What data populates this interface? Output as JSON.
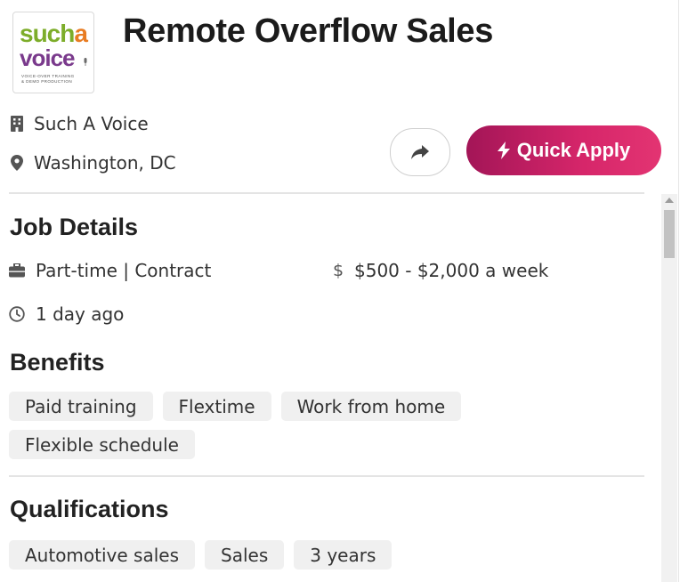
{
  "company_logo": {
    "line1a": "such",
    "line1b": "a",
    "line2": "voice",
    "tagline1": "VOICE-OVER TRAINING",
    "tagline2": "& DEMO PRODUCTION"
  },
  "job": {
    "title": "Remote Overflow Sales",
    "company": "Such A Voice",
    "location": "Washington, DC"
  },
  "actions": {
    "quick_apply": "Quick Apply"
  },
  "details": {
    "heading": "Job Details",
    "job_type": "Part-time | Contract",
    "salary": "$500 - $2,000 a week",
    "posted": "1 day ago"
  },
  "benefits": {
    "heading": "Benefits",
    "items": [
      "Paid training",
      "Flextime",
      "Work from home",
      "Flexible schedule"
    ]
  },
  "qualifications": {
    "heading": "Qualifications",
    "items": [
      "Automotive sales",
      "Sales",
      "3 years"
    ]
  },
  "colors": {
    "accent_start": "#a31557",
    "accent_end": "#e33472"
  },
  "icons": [
    "building-icon",
    "location-pin-icon",
    "share-icon",
    "lightning-icon",
    "briefcase-icon",
    "dollar-icon",
    "clock-icon"
  ]
}
